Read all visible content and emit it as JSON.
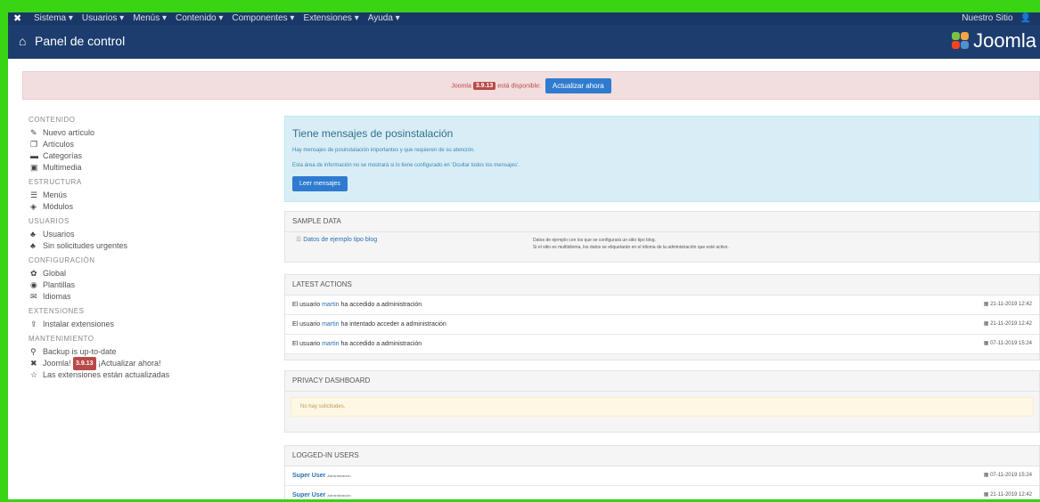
{
  "topbar": {
    "menus": [
      "Sistema ▾",
      "Usuarios ▾",
      "Menús ▾",
      "Contenido ▾",
      "Componentes ▾",
      "Extensiones ▾",
      "Ayuda ▾"
    ],
    "site_label": "Nuestro Sitio",
    "user_label": "👤"
  },
  "header": {
    "title": "Panel de control",
    "brand": "Joomla"
  },
  "update": {
    "prefix": "Joomla",
    "version": "3.9.13",
    "suffix": "está disponible:",
    "button": "Actualizar ahora"
  },
  "sidebar": {
    "contenido": {
      "title": "CONTENIDO",
      "items": [
        "Nuevo artículo",
        "Artículos",
        "Categorías",
        "Multimedia"
      ]
    },
    "estructura": {
      "title": "ESTRUCTURA",
      "items": [
        "Menús",
        "Módulos"
      ]
    },
    "usuarios": {
      "title": "USUARIOS",
      "items": [
        "Usuarios",
        "Sin solicitudes urgentes"
      ]
    },
    "configuracion": {
      "title": "CONFIGURACIÓN",
      "items": [
        "Global",
        "Plantillas",
        "Idiomas"
      ]
    },
    "extensiones": {
      "title": "EXTENSIONES",
      "items": [
        "Instalar extensiones"
      ]
    },
    "mantenimiento": {
      "title": "MANTENIMIENTO",
      "items": [
        "Backup is up-to-date",
        "Joomla!",
        "¡Actualizar ahora!",
        "Las extensiones están actualizadas"
      ],
      "joomla_version": "3.9.13"
    }
  },
  "postinstall": {
    "title": "Tiene mensajes de posinstalación",
    "line1": "Hay mensajes de posinstalación importantes y que requieren de su atención.",
    "line2": "Esta área de información no se mostrará si lo tiene configurado en 'Ocultar todos los mensajes'.",
    "button": "Leer mensajes"
  },
  "sample": {
    "header": "SAMPLE DATA",
    "item": "Datos de ejemplo tipo blog",
    "desc1": "Datos de ejemplo con los que se configurará un sitio tipo blog.",
    "desc2": "Si el sitio es multiidioma, los datos se etiquetarán en el idioma de la administración que esté activo."
  },
  "latest": {
    "header": "LATEST ACTIONS",
    "rows": [
      {
        "pre": "El usuario",
        "user": "martin",
        "post": "ha accedido a administración",
        "date": "21-11-2019 12:42"
      },
      {
        "pre": "El usuario",
        "user": "martin",
        "post": "ha intentado acceder a administración",
        "date": "21-11-2019 12:42"
      },
      {
        "pre": "El usuario",
        "user": "martin",
        "post": "ha accedido a administración",
        "date": "07-11-2019 15:24"
      }
    ]
  },
  "privacy": {
    "header": "PRIVACY DASHBOARD",
    "message": "No hay solicitudes."
  },
  "logged": {
    "header": "LOGGED-IN USERS",
    "rows": [
      {
        "name": "Super User",
        "area": "Administración",
        "date": "07-11-2019 15:24"
      },
      {
        "name": "Super User",
        "area": "Administración",
        "date": "21-11-2019 12:42"
      }
    ]
  },
  "colors": {
    "header": "#1c3d6e",
    "topbar": "#1a3867",
    "accent": "#2f7bd0",
    "frame": "#39d414"
  }
}
